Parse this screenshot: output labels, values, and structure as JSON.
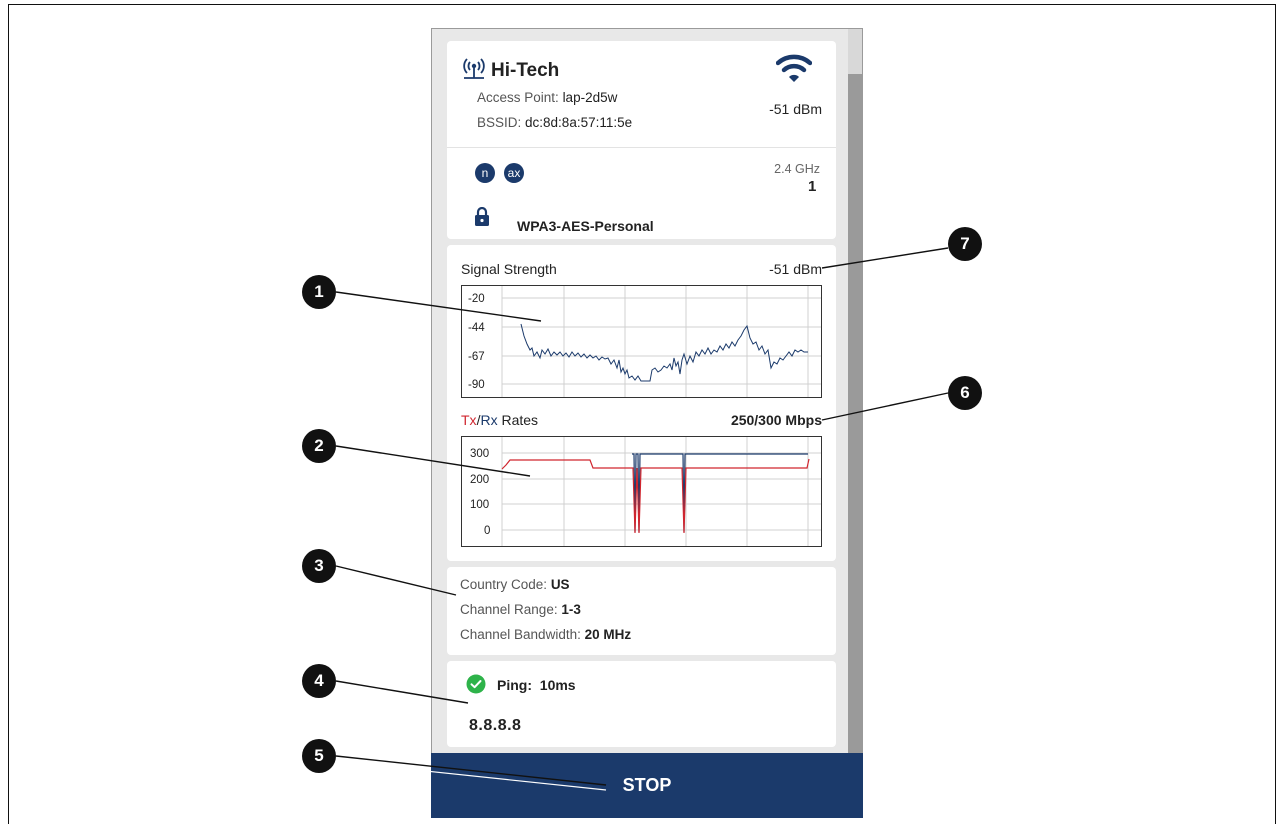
{
  "network": {
    "name": "Hi-Tech",
    "access_point_label": "Access Point:",
    "access_point_value": "lap-2d5w",
    "bssid_label": "BSSID:",
    "bssid_value": "dc:8d:8a:57:11:5e",
    "signal_dbm": "-51 dBm",
    "standards": [
      "n",
      "ax"
    ],
    "band": "2.4 GHz",
    "channel": "1",
    "security": "WPA3-AES-Personal"
  },
  "signal_chart": {
    "label": "Signal Strength",
    "value": "-51 dBm",
    "y_ticks": [
      "-20",
      "-44",
      "-67",
      "-90"
    ]
  },
  "rates_chart": {
    "label_tx": "Tx",
    "label_sep": "/",
    "label_rx": "Rx",
    "label_rest": " Rates",
    "value": "250/300 Mbps",
    "y_ticks": [
      "300",
      "200",
      "100",
      "0"
    ]
  },
  "details": {
    "country_label": "Country Code:",
    "country_value": "US",
    "range_label": "Channel Range:",
    "range_value": "1-3",
    "bandwidth_label": "Channel Bandwidth:",
    "bandwidth_value": "20 MHz"
  },
  "ping": {
    "label": "Ping:",
    "value": "10ms",
    "host": "8.8.8.8"
  },
  "stop_button": {
    "label": "STOP"
  },
  "callouts": [
    "1",
    "2",
    "3",
    "4",
    "5",
    "6",
    "7"
  ],
  "colors": {
    "brand": "#1b3a6b",
    "tx": "#d0262f",
    "rx": "#1b3a6b",
    "ok": "#2eb34a"
  }
}
